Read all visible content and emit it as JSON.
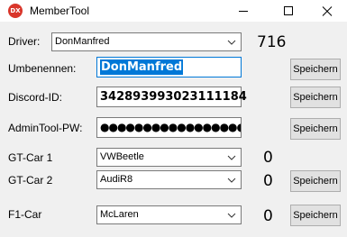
{
  "window": {
    "title": "MemberTool",
    "icon_text": "DX",
    "icons": [
      "minimize-icon",
      "maximize-icon",
      "close-icon"
    ]
  },
  "driver": {
    "label": "Driver:",
    "selected": "DonManfred",
    "count": "716"
  },
  "rename": {
    "label": "Umbenennen:",
    "value": "DonManfred",
    "button": "Speichern"
  },
  "discord": {
    "label": "Discord-ID:",
    "value": "342893993023111184",
    "button": "Speichern"
  },
  "admin_pw": {
    "label": "AdminTool-PW:",
    "value": "●●●●●●●●●●●●●●●●●●●●●●",
    "button": "Speichern"
  },
  "gt_car_1": {
    "label": "GT-Car 1",
    "selected": "VWBeetle",
    "count": "0"
  },
  "gt_car_2": {
    "label": "GT-Car 2",
    "selected": "AudiR8",
    "count": "0",
    "button": "Speichern"
  },
  "f1_car": {
    "label": "F1-Car",
    "selected": "McLaren",
    "count": "0",
    "button": "Speichern"
  }
}
